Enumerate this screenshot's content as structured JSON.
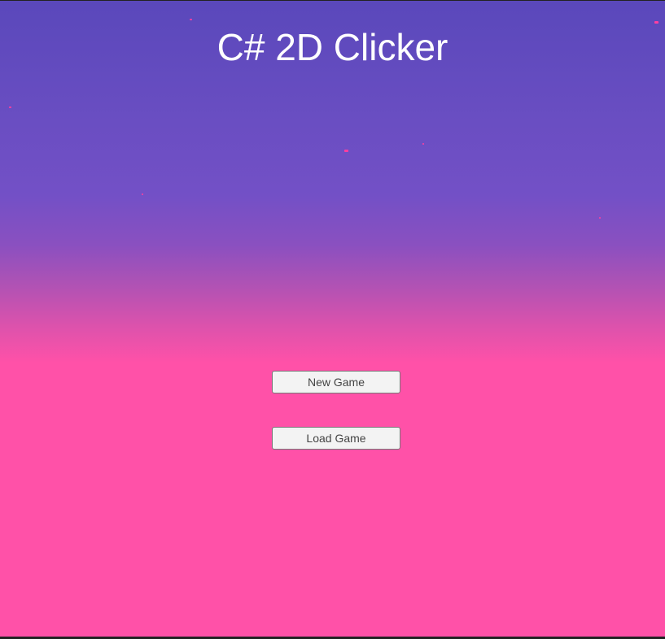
{
  "title": "C# 2D Clicker",
  "buttons": {
    "new_game": "New Game",
    "load_game": "Load Game"
  },
  "colors": {
    "top": "#5a48bb",
    "bottom": "#ff51a8",
    "particle": "#ff3fa0"
  }
}
